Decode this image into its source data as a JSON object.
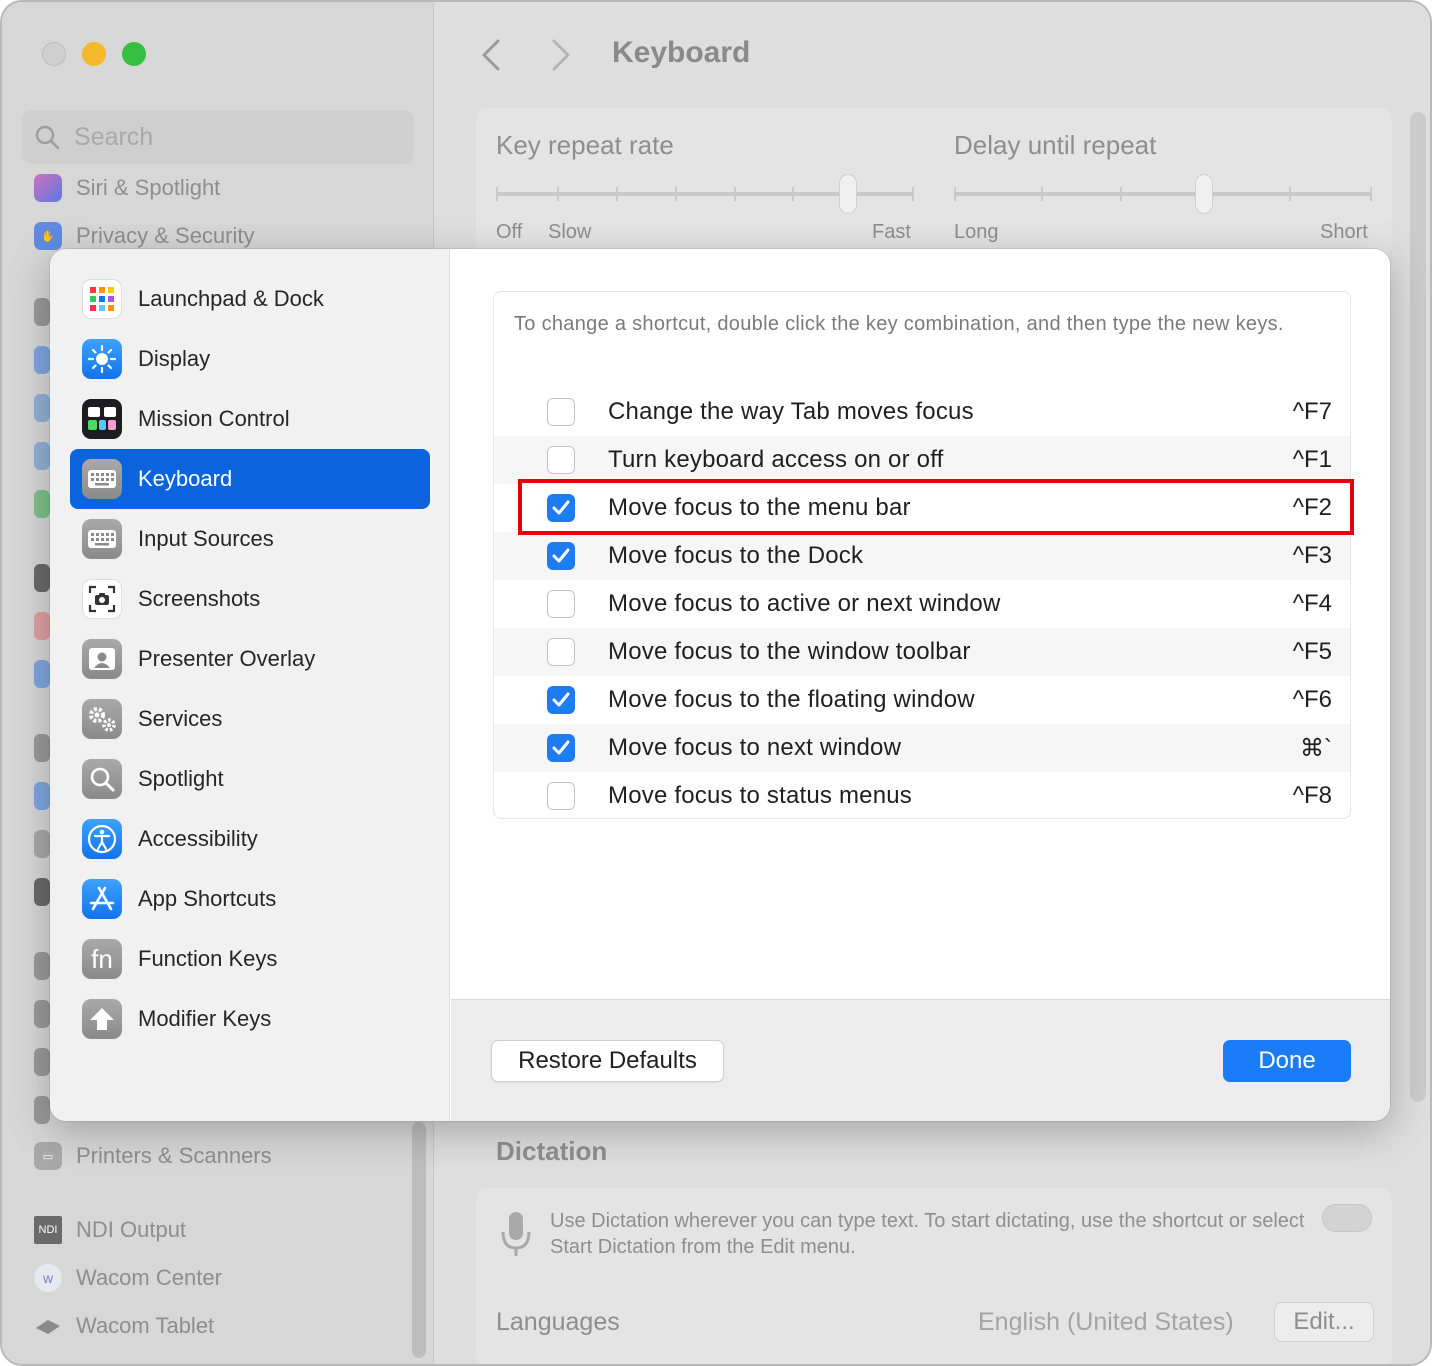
{
  "window": {
    "title": "Keyboard"
  },
  "background": {
    "search_placeholder": "Search",
    "sidebar_top": [
      "Siri & Spotlight",
      "Privacy & Security"
    ],
    "sidebar_bottom": [
      {
        "label": "Printers & Scanners",
        "icon": "printer-icon"
      },
      {
        "label": "NDI Output",
        "icon": "ndi-icon",
        "icon_text": "NDI"
      },
      {
        "label": "Wacom Center",
        "icon": "wacom-icon",
        "icon_text": "w"
      },
      {
        "label": "Wacom Tablet",
        "icon": "tablet-icon"
      }
    ],
    "key_repeat": {
      "title": "Key repeat rate",
      "left": "Off",
      "left2": "Slow",
      "right": "Fast"
    },
    "delay_repeat": {
      "title": "Delay until repeat",
      "left": "Long",
      "right": "Short"
    },
    "dictation": {
      "title": "Dictation",
      "description": "Use Dictation wherever you can type text. To start dictating, use the shortcut or select Start Dictation from the Edit menu."
    },
    "languages": {
      "label": "Languages",
      "value": "English (United States)",
      "edit": "Edit..."
    }
  },
  "sheet": {
    "sidebar": [
      {
        "label": "Launchpad & Dock",
        "icon": "launchpad-icon",
        "selected": false
      },
      {
        "label": "Display",
        "icon": "display-icon",
        "selected": false
      },
      {
        "label": "Mission Control",
        "icon": "mission-control-icon",
        "selected": false
      },
      {
        "label": "Keyboard",
        "icon": "keyboard-icon",
        "selected": true
      },
      {
        "label": "Input Sources",
        "icon": "input-sources-icon",
        "selected": false
      },
      {
        "label": "Screenshots",
        "icon": "screenshot-icon",
        "selected": false
      },
      {
        "label": "Presenter Overlay",
        "icon": "presenter-icon",
        "selected": false
      },
      {
        "label": "Services",
        "icon": "gears-icon",
        "selected": false
      },
      {
        "label": "Spotlight",
        "icon": "spotlight-icon",
        "selected": false
      },
      {
        "label": "Accessibility",
        "icon": "accessibility-icon",
        "selected": false
      },
      {
        "label": "App Shortcuts",
        "icon": "app-store-icon",
        "selected": false
      },
      {
        "label": "Function Keys",
        "icon": "fn-icon",
        "icon_text": "fn",
        "selected": false
      },
      {
        "label": "Modifier Keys",
        "icon": "up-arrow-icon",
        "selected": false
      }
    ],
    "hint": "To change a shortcut, double click the key combination, and then type the new keys.",
    "shortcuts": [
      {
        "label": "Change the way Tab moves focus",
        "key": "^F7",
        "checked": false
      },
      {
        "label": "Turn keyboard access on or off",
        "key": "^F1",
        "checked": false
      },
      {
        "label": "Move focus to the menu bar",
        "key": "^F2",
        "checked": true,
        "highlighted": true
      },
      {
        "label": "Move focus to the Dock",
        "key": "^F3",
        "checked": true
      },
      {
        "label": "Move focus to active or next window",
        "key": "^F4",
        "checked": false
      },
      {
        "label": "Move focus to the window toolbar",
        "key": "^F5",
        "checked": false
      },
      {
        "label": "Move focus to the floating window",
        "key": "^F6",
        "checked": true
      },
      {
        "label": "Move focus to next window",
        "key": "⌘`",
        "checked": true
      },
      {
        "label": "Move focus to status menus",
        "key": "^F8",
        "checked": false
      }
    ],
    "restore_label": "Restore Defaults",
    "done_label": "Done"
  },
  "colors": {
    "accent": "#1a7cf6",
    "selected": "#0b63de",
    "highlight": "#e3000b"
  }
}
